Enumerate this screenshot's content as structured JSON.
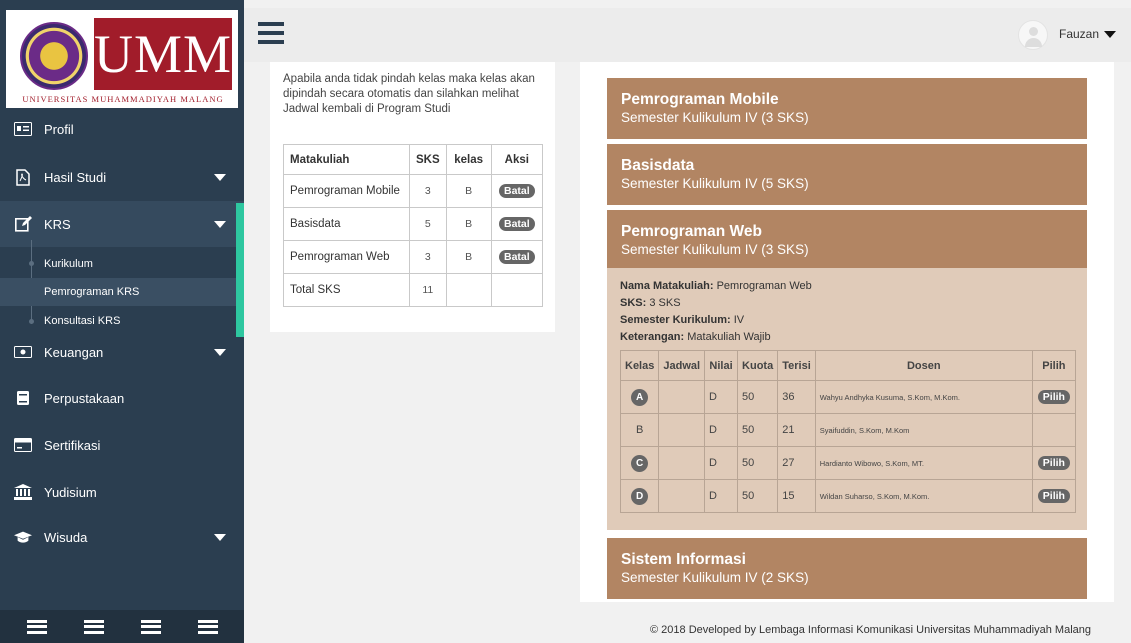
{
  "brand": {
    "logo_text": "UMM",
    "subtitle": "UNIVERSITAS MUHAMMADIYAH MALANG"
  },
  "sidebar": {
    "items": [
      {
        "label": "Profil",
        "icon": "id-card-icon"
      },
      {
        "label": "Hasil Studi",
        "icon": "pdf-file-icon"
      },
      {
        "label": "KRS",
        "icon": "edit-icon"
      },
      {
        "label": "Keuangan",
        "icon": "money-icon"
      },
      {
        "label": "Perpustakaan",
        "icon": "book-icon"
      },
      {
        "label": "Sertifikasi",
        "icon": "certificate-icon"
      },
      {
        "label": "Yudisium",
        "icon": "institution-icon"
      },
      {
        "label": "Wisuda",
        "icon": "graduation-cap-icon"
      }
    ],
    "krs_subitems": [
      "Kurikulum",
      "Pemrograman KRS",
      "Konsultasi KRS"
    ],
    "active_subitem": "Pemrograman KRS"
  },
  "user": {
    "name": "Fauzan"
  },
  "notice": "Apabila anda tidak pindah kelas maka kelas akan dipindah secara otomatis dan silahkan melihat Jadwal kembali di Program Studi",
  "krs_table": {
    "headers": [
      "Matakuliah",
      "SKS",
      "kelas",
      "Aksi"
    ],
    "rows": [
      {
        "matakuliah": "Pemrograman Mobile",
        "sks": "3",
        "kelas": "B",
        "aksi": "Batal"
      },
      {
        "matakuliah": "Basisdata",
        "sks": "5",
        "kelas": "B",
        "aksi": "Batal"
      },
      {
        "matakuliah": "Pemrograman Web",
        "sks": "3",
        "kelas": "B",
        "aksi": "Batal"
      }
    ],
    "total_label": "Total SKS",
    "total_value": "11"
  },
  "courses": [
    {
      "title": "Pemrograman Mobile",
      "semester": "Semester Kulikulum IV (3 SKS)"
    },
    {
      "title": "Basisdata",
      "semester": "Semester Kulikulum IV (5 SKS)"
    },
    {
      "title": "Pemrograman Web",
      "semester": "Semester Kulikulum IV (3 SKS)"
    },
    {
      "title": "Sistem Informasi",
      "semester": "Semester Kulikulum IV (2 SKS)"
    }
  ],
  "detail": {
    "nama_label": "Nama Matakuliah:",
    "nama_value": "Pemrograman Web",
    "sks_label": "SKS:",
    "sks_value": "3 SKS",
    "semester_label": "Semester Kurikulum:",
    "semester_value": "IV",
    "keterangan_label": "Keterangan:",
    "keterangan_value": "Matakuliah Wajib"
  },
  "kelas_table": {
    "headers": [
      "Kelas",
      "Jadwal",
      "Nilai",
      "Kuota",
      "Terisi",
      "Dosen",
      "Pilih"
    ],
    "rows": [
      {
        "kelas": "A",
        "jadwal": "",
        "nilai": "D",
        "kuota": "50",
        "terisi": "36",
        "dosen": "Wahyu Andhyka Kusuma, S.Kom, M.Kom.",
        "pilih": "Pilih"
      },
      {
        "kelas": "B",
        "jadwal": "",
        "nilai": "D",
        "kuota": "50",
        "terisi": "21",
        "dosen": "Syaifuddin, S.Kom, M.Kom",
        "pilih": ""
      },
      {
        "kelas": "C",
        "jadwal": "",
        "nilai": "D",
        "kuota": "50",
        "terisi": "27",
        "dosen": "Hardianto Wibowo, S.Kom, MT.",
        "pilih": "Pilih"
      },
      {
        "kelas": "D",
        "jadwal": "",
        "nilai": "D",
        "kuota": "50",
        "terisi": "15",
        "dosen": "Wildan Suharso, S.Kom, M.Kom.",
        "pilih": "Pilih"
      }
    ]
  },
  "footer": "© 2018 Developed by Lembaga Informasi Komunikasi Universitas Muhammadiyah Malang",
  "colors": {
    "sidebar": "#2b3e50",
    "accent": "#2ec7a0",
    "course_header": "#b28563",
    "course_body": "#e0cbb9",
    "brand_red": "#a11c2a"
  }
}
